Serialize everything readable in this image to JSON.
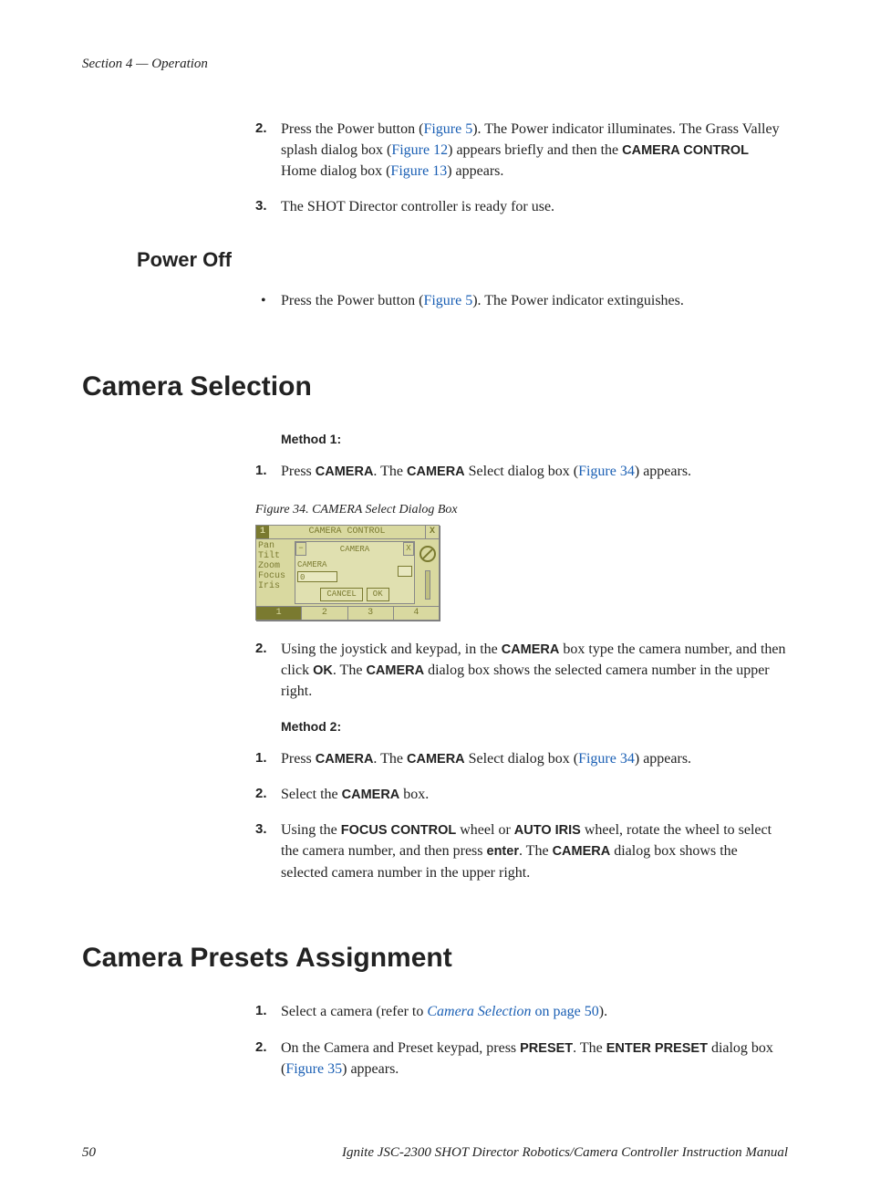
{
  "header": "Section 4 — Operation",
  "top_steps": {
    "s2_prefix": "Press the Power button (",
    "s2_link1": "Figure 5",
    "s2_mid1": "). The Power indicator illuminates. The Grass Valley splash dialog box (",
    "s2_link2": "Figure 12",
    "s2_mid2": ") appears briefly and then the ",
    "s2_bold": "CAMERA CONTROL",
    "s2_mid3": " Home dialog box (",
    "s2_link3": "Figure 13",
    "s2_end": ") appears.",
    "s3": "The SHOT Director controller is ready for use."
  },
  "poweroff": {
    "heading": "Power Off",
    "b1_prefix": "Press the Power button (",
    "b1_link": "Figure 5",
    "b1_end": "). The Power indicator extinguishes."
  },
  "camsel": {
    "heading": "Camera Selection",
    "m1": "Method 1:",
    "s1_prefix": "Press ",
    "s1_b1": "CAMERA",
    "s1_mid": ". The ",
    "s1_b2": "CAMERA",
    "s1_mid2": " Select dialog box (",
    "s1_link": "Figure 34",
    "s1_end": ") appears.",
    "figcap": "Figure 34.  CAMERA Select Dialog Box",
    "fig": {
      "title": "CAMERA CONTROL",
      "num": "1",
      "left": [
        "Pan",
        "Tilt",
        "Zoom",
        "Focus",
        "Iris"
      ],
      "midtitle": "CAMERA",
      "camlabel": "CAMERA",
      "inputval": "0",
      "cancel": "CANCEL",
      "ok": "OK",
      "bottom": [
        "1",
        "2",
        "3",
        "4"
      ]
    },
    "s2_prefix": "Using the joystick and keypad, in the ",
    "s2_b1": "CAMERA",
    "s2_mid1": " box type the camera number, and then click ",
    "s2_b2": "OK",
    "s2_mid2": ". The ",
    "s2_b3": "CAMERA",
    "s2_end": " dialog box shows the selected camera number in the upper right.",
    "m2": "Method 2:",
    "m2s1_prefix": "Press ",
    "m2s1_b1": "CAMERA",
    "m2s1_mid": ". The ",
    "m2s1_b2": "CAMERA",
    "m2s1_mid2": " Select dialog box (",
    "m2s1_link": "Figure 34",
    "m2s1_end": ") appears.",
    "m2s2_prefix": "Select the ",
    "m2s2_b1": "CAMERA",
    "m2s2_end": " box.",
    "m2s3_prefix": "Using the ",
    "m2s3_b1": "FOCUS CONTROL",
    "m2s3_mid1": " wheel or ",
    "m2s3_b2": "AUTO IRIS",
    "m2s3_mid2": " wheel, rotate the wheel to select the camera number, and then press ",
    "m2s3_b3": "enter",
    "m2s3_mid3": ". The ",
    "m2s3_b4": "CAMERA",
    "m2s3_end": " dialog box shows the selected camera number in the upper right."
  },
  "campreset": {
    "heading": "Camera Presets Assignment",
    "s1_prefix": "Select a camera (refer to ",
    "s1_link_italic": "Camera Selection",
    "s1_link_rest": " on page 50",
    "s1_end": ").",
    "s2_prefix": "On the Camera and Preset keypad, press ",
    "s2_b1": "PRESET",
    "s2_mid": ". The ",
    "s2_b2": "ENTER PRESET",
    "s2_mid2": " dialog box (",
    "s2_link": "Figure 35",
    "s2_end": ") appears."
  },
  "footer": {
    "page": "50",
    "title": "Ignite JSC-2300 SHOT Director Robotics/Camera Controller Instruction Manual"
  }
}
